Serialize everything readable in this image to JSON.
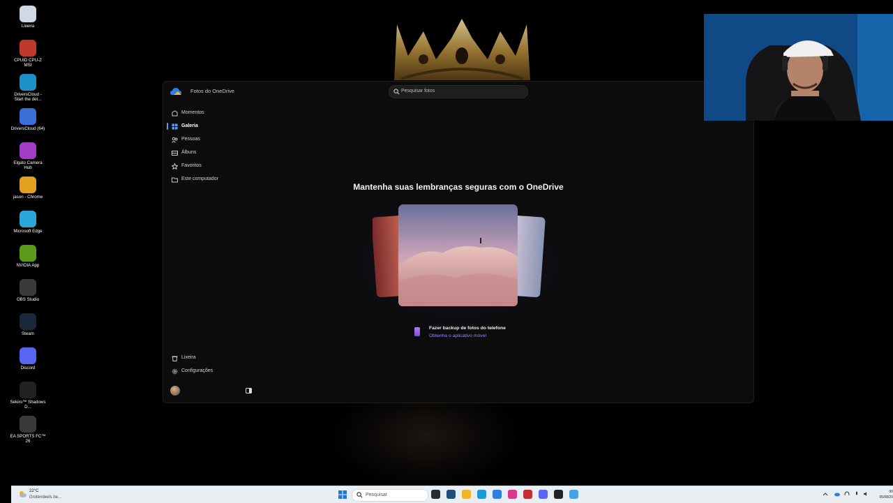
{
  "desktop": {
    "icons": [
      {
        "label": "Lixeira",
        "icon": "recycle-bin-icon",
        "color": "#cfd8e3"
      },
      {
        "label": "CPUID CPU-Z MSI",
        "icon": "cpuz-icon",
        "color": "#c0392b"
      },
      {
        "label": "DriversCloud - Start the det...",
        "icon": "edge-icon",
        "color": "#1e90c8"
      },
      {
        "label": "DriversCloud (64)",
        "icon": "driverscloud-icon",
        "color": "#3b6fd6"
      },
      {
        "label": "Elgato Camera Hub",
        "icon": "camera-hub-icon",
        "color": "#a23cc4"
      },
      {
        "label": "jason - Chrome",
        "icon": "chrome-icon",
        "color": "#e0a020"
      },
      {
        "label": "Microsoft Edge",
        "icon": "edge-icon",
        "color": "#2aa6d8"
      },
      {
        "label": "NVIDIA App",
        "icon": "nvidia-icon",
        "color": "#5a9c1a"
      },
      {
        "label": "OBS Studio",
        "icon": "obs-icon",
        "color": "#3a3a3a"
      },
      {
        "label": "Steam",
        "icon": "steam-icon",
        "color": "#1b2838"
      },
      {
        "label": "Discord",
        "icon": "discord-icon",
        "color": "#5865f2"
      },
      {
        "label": "Sekiro™ Shadows D...",
        "icon": "sekiro-icon",
        "color": "#222222"
      },
      {
        "label": "EA SPORTS FC™ 26",
        "icon": "ea-fc-icon",
        "color": "#3a3a3a"
      }
    ]
  },
  "window": {
    "title": "Fotos do OneDrive",
    "search_placeholder": "Pesquisar fotos",
    "nav": [
      {
        "label": "Momentos",
        "icon": "moments-icon",
        "active": false
      },
      {
        "label": "Galeria",
        "icon": "gallery-icon",
        "active": true
      },
      {
        "label": "Pessoas",
        "icon": "people-icon",
        "active": false
      },
      {
        "label": "Álbuns",
        "icon": "albums-icon",
        "active": false
      },
      {
        "label": "Favoritos",
        "icon": "star-icon",
        "active": false
      },
      {
        "label": "Este computador",
        "icon": "folder-icon",
        "active": false
      }
    ],
    "bottom_nav": [
      {
        "label": "Lixeira",
        "icon": "trash-icon"
      },
      {
        "label": "Configurações",
        "icon": "gear-icon"
      }
    ],
    "headline": "Mantenha suas lembranças seguras com o OneDrive",
    "promo": {
      "title": "Fazer backup de fotos do telefone",
      "link": "Obtenha o aplicativo móvel"
    },
    "accent": "#4ca0ff",
    "link_color": "#9a86ff"
  },
  "taskbar": {
    "weather_temp": "22°C",
    "weather_condition": "Grotendeels be...",
    "search_placeholder": "Pesquisar",
    "clock_time": "00",
    "clock_date": "05/08/20"
  }
}
